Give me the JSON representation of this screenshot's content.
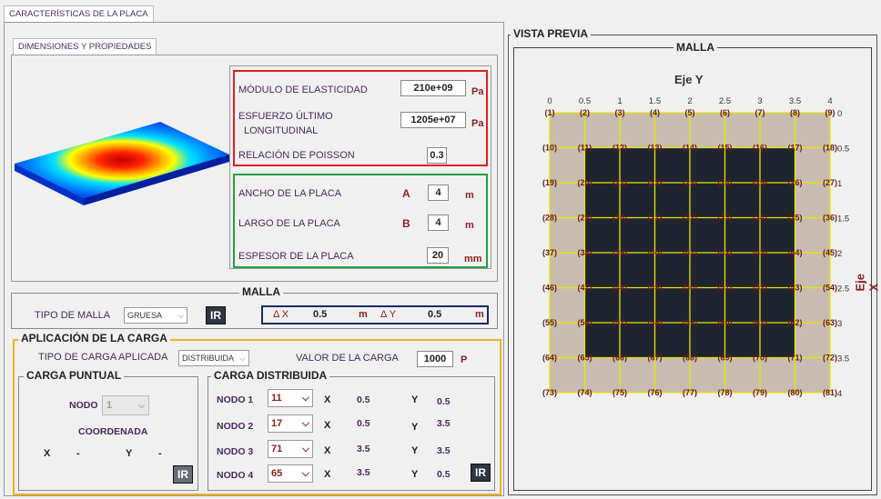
{
  "main_tab": "CARACTERÍSTICAS DE LA PLACA",
  "dims_tab": "DIMENSIONES Y PROPIEDADES",
  "props": {
    "modulo_label": "MÓDULO DE ELASTICIDAD",
    "modulo_value": "210e+09",
    "modulo_unit": "Pa",
    "esfuerzo_label_1": "ESFUERZO ÚLTIMO",
    "esfuerzo_label_2": "LONGITUDINAL",
    "esfuerzo_value": "1205e+07",
    "esfuerzo_unit": "Pa",
    "poisson_label": "RELACIÓN DE POISSON",
    "poisson_value": "0.3"
  },
  "dims": {
    "ancho_label": "ANCHO DE LA PLACA",
    "ancho_sym": "A",
    "ancho_value": "4",
    "ancho_unit": "m",
    "largo_label": "LARGO DE LA PLACA",
    "largo_sym": "B",
    "largo_value": "4",
    "largo_unit": "m",
    "espesor_label": "ESPESOR DE LA PLACA",
    "espesor_value": "20",
    "espesor_unit": "mm"
  },
  "malla": {
    "title": "MALLA",
    "tipo_label": "TIPO DE MALLA",
    "tipo_value": "GRUESA",
    "ir_label": "IR",
    "dx_label": "Δ X",
    "dx_value": "0.5",
    "dx_unit": "m",
    "dy_label": "Δ Y",
    "dy_value": "0.5",
    "dy_unit": "m"
  },
  "carga": {
    "title": "APLICACIÓN DE LA CARGA",
    "tipo_label": "TIPO DE CARGA APLICADA",
    "tipo_value": "DISTRIBUIDA",
    "valor_label": "VALOR DE LA CARGA",
    "valor_value": "1000",
    "valor_unit": "P"
  },
  "puntual": {
    "title": "CARGA PUNTUAL",
    "nodo_label": "NODO",
    "nodo_value": "1",
    "coord_label": "COORDENADA",
    "x_label": "X",
    "x_value": "-",
    "y_label": "Y",
    "y_value": "-",
    "ir_label": "IR"
  },
  "distribuida": {
    "title": "CARGA DISTRIBUIDA",
    "ir_label": "IR",
    "x_label": "X",
    "y_label": "Y",
    "rows": [
      {
        "label": "NODO 1",
        "node": "11",
        "x": "0.5",
        "y": "0.5"
      },
      {
        "label": "NODO 2",
        "node": "17",
        "x": "0.5",
        "y": "3.5"
      },
      {
        "label": "NODO 3",
        "node": "71",
        "x": "3.5",
        "y": "3.5"
      },
      {
        "label": "NODO 4",
        "node": "65",
        "x": "3.5",
        "y": "0.5"
      }
    ]
  },
  "preview": {
    "title": "VISTA PREVIA",
    "mesh_title": "MALLA",
    "axis_y_label": "Eje Y",
    "axis_x_label": "Eje X",
    "col_ticks": [
      "0",
      "0.5",
      "1",
      "1.5",
      "2",
      "2.5",
      "3",
      "3.5",
      "4"
    ],
    "row_ticks": [
      "0",
      "0.5",
      "1",
      "1.5",
      "2",
      "2.5",
      "3",
      "3.5",
      "4"
    ],
    "grid_n": 9,
    "loaded_region": {
      "x_from": 0.5,
      "x_to": 3.5,
      "y_from": 0.5,
      "y_to": 3.5
    },
    "colors": {
      "plate": "#c8bcb0",
      "loaded": "#1e2430",
      "lines": "#e6e600",
      "node_text": "#6b1a1a"
    }
  }
}
